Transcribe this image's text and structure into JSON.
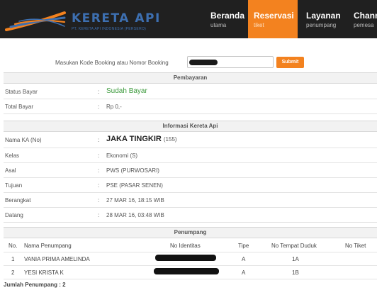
{
  "header": {
    "logo_title": "KERETA API",
    "logo_subtitle": "PT. KERETA API INDONESIA (PERSERO)",
    "nav": [
      {
        "title": "Beranda",
        "subtitle": "utama",
        "active": false
      },
      {
        "title": "Reservasi",
        "subtitle": "tiket",
        "active": true
      },
      {
        "title": "Layanan",
        "subtitle": "penumpang",
        "active": false
      },
      {
        "title": "Chann",
        "subtitle": "pemesa",
        "active": false
      }
    ],
    "accent_color": "#f3821f",
    "brand_color": "#3d6fb0"
  },
  "search": {
    "label": "Masukan Kode Booking atau Nomor Booking",
    "submit_label": "Submit"
  },
  "payment": {
    "heading": "Pembayaran",
    "status_label": "Status Bayar",
    "status_value": "Sudah Bayar",
    "total_label": "Total Bayar",
    "total_value": "Rp 0,-"
  },
  "train": {
    "heading": "Informasi Kereta Api",
    "colon": ":",
    "name_label": "Nama KA (No)",
    "name_value": "JAKA TINGKIR",
    "name_number": "(155)",
    "class_label": "Kelas",
    "class_value": "Ekonomi (S)",
    "origin_label": "Asal",
    "origin_value": "PWS (PURWOSARI)",
    "dest_label": "Tujuan",
    "dest_value": "PSE (PASAR SENEN)",
    "depart_label": "Berangkat",
    "depart_value": "27 MAR 16, 18:15 WIB",
    "arrive_label": "Datang",
    "arrive_value": "28 MAR 16, 03:48 WIB"
  },
  "passengers": {
    "heading": "Penumpang",
    "columns": [
      "No.",
      "Nama Penumpang",
      "No Identitas",
      "Tipe",
      "No Tempat Duduk",
      "No Tiket"
    ],
    "rows": [
      {
        "no": "1",
        "name": "VANIA PRIMA AMELINDA",
        "type": "A",
        "seat": "1A"
      },
      {
        "no": "2",
        "name": "YESI KRISTA K",
        "type": "A",
        "seat": "1B"
      }
    ],
    "total": "Jumlah Penumpang : 2"
  }
}
